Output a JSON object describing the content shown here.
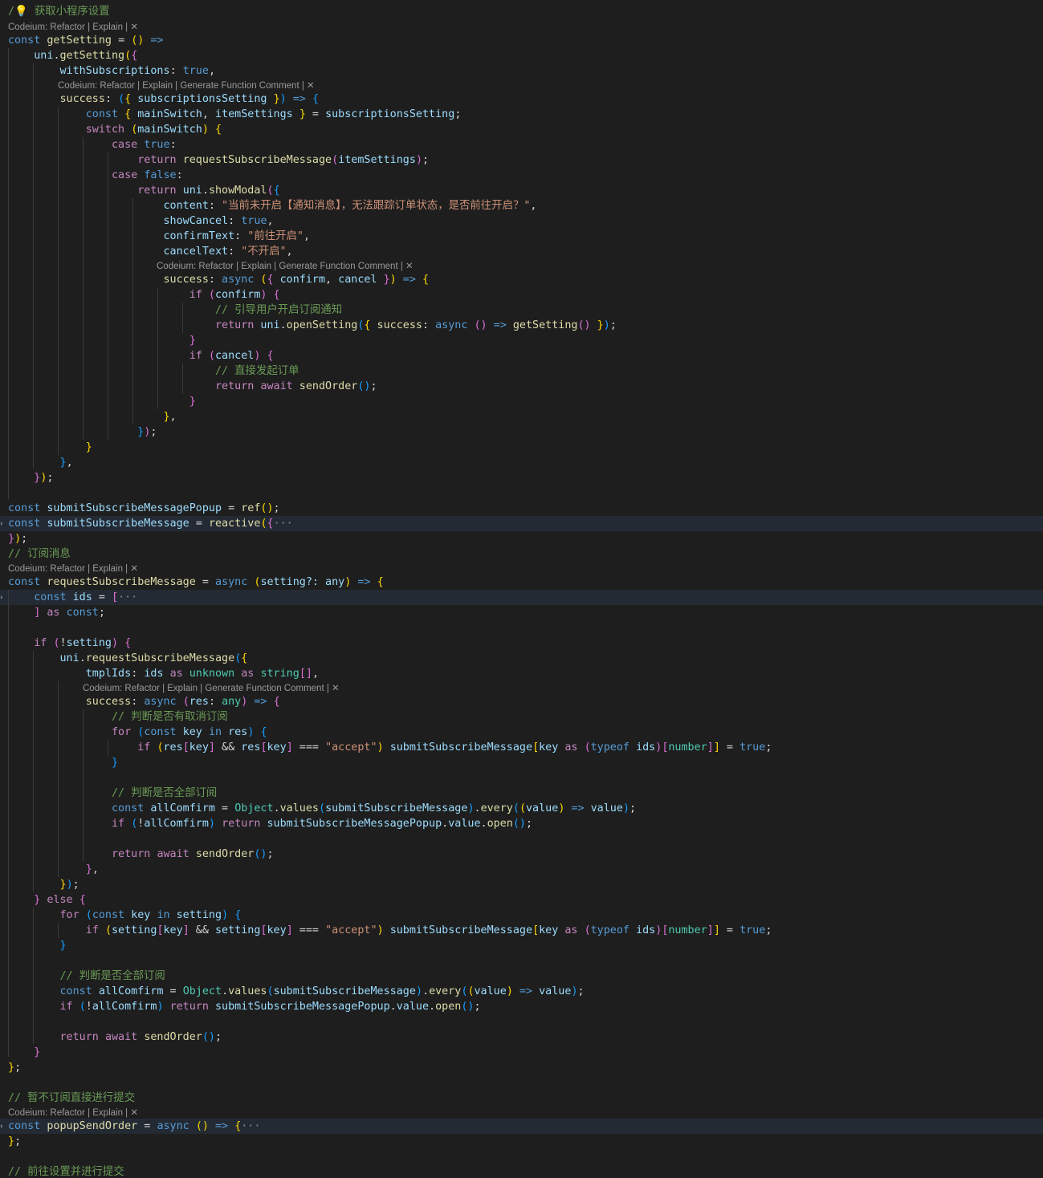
{
  "code_lens": {
    "short": "Codeium: Refactor | Explain | ",
    "long": "Codeium: Refactor | Explain | Generate Function Comment | ",
    "close": "✕"
  },
  "lines": {
    "l1_comment": "获取小程序设置",
    "l2": "getSetting",
    "l4": "withSubscriptions",
    "l6": "subscriptionsSetting",
    "l7a": "mainSwitch",
    "l7b": "itemSettings",
    "l11": "requestSubscribeMessage",
    "l14": "showModal",
    "l15_str": "\"当前未开启【通知消息】，无法跟踪订单状态，是否前往开启？\"",
    "l17_str": "\"前往开启\"",
    "l18_str": "\"不开启\"",
    "l21_comment": "// 引导用户开启订阅通知",
    "l25_comment": "// 直接发起订单",
    "l33": "submitSubscribeMessagePopup",
    "l34": "submitSubscribeMessage",
    "l36_comment": "// 订阅消息",
    "l37_type": "setting?: any",
    "l46_comment": "// 判断是否有取消订阅",
    "l48_str": "\"accept\"",
    "l51_comment": "// 判断是否全部订阅",
    "l52": "allComfirm",
    "l71_comment": "// 暂不订阅直接进行提交",
    "l72": "popupSendOrder",
    "l75_comment": "// 前往设置并进行提交"
  }
}
